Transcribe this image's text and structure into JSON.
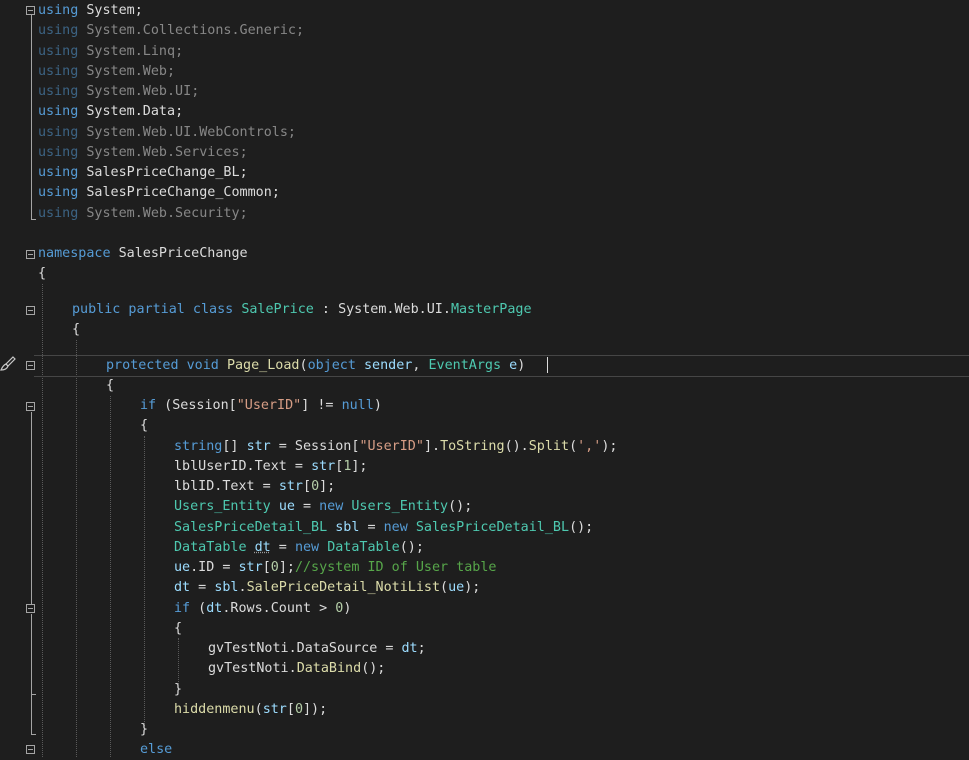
{
  "editor": {
    "usings": [
      {
        "kw": "using",
        "ns": "System",
        "used": true
      },
      {
        "kw": "using",
        "ns": "System.Collections.Generic",
        "used": false
      },
      {
        "kw": "using",
        "ns": "System.Linq",
        "used": false
      },
      {
        "kw": "using",
        "ns": "System.Web",
        "used": false
      },
      {
        "kw": "using",
        "ns": "System.Web.UI",
        "used": false
      },
      {
        "kw": "using",
        "ns": "System.Data",
        "used": true
      },
      {
        "kw": "using",
        "ns": "System.Web.UI.WebControls",
        "used": false
      },
      {
        "kw": "using",
        "ns": "System.Web.Services",
        "used": false
      },
      {
        "kw": "using",
        "ns": "SalesPriceChange_BL",
        "used": true
      },
      {
        "kw": "using",
        "ns": "SalesPriceChange_Common",
        "used": true
      },
      {
        "kw": "using",
        "ns": "System.Web.Security",
        "used": false
      }
    ],
    "namespace_kw": "namespace",
    "namespace_name": "SalesPriceChange",
    "class_modifiers": "public partial class",
    "class_name": "SalePrice",
    "class_base_prefix": "System.Web.UI.",
    "class_base": "MasterPage",
    "method_modifiers": "protected void",
    "method_name": "Page_Load",
    "param1_type": "object",
    "param1_name": "sender",
    "param2_type": "EventArgs",
    "param2_name": "e",
    "session_key": "\"UserID\"",
    "null_kw": "null",
    "split_arg": "','",
    "idx0": "0",
    "idx1": "1",
    "comment": "//system ID of User table",
    "compare_value": "0",
    "else_kw": "else"
  },
  "colors": {
    "background": "#1e1e1e",
    "keyword": "#569cd6",
    "type": "#4ec9b0",
    "method": "#dcdcaa",
    "string": "#d69d85",
    "comment": "#57a64a",
    "parameter": "#9cdcfe",
    "number": "#b5cea8"
  },
  "icons": {
    "gutter": "paintbrush-icon",
    "fold": "collapse-minus-icon"
  }
}
